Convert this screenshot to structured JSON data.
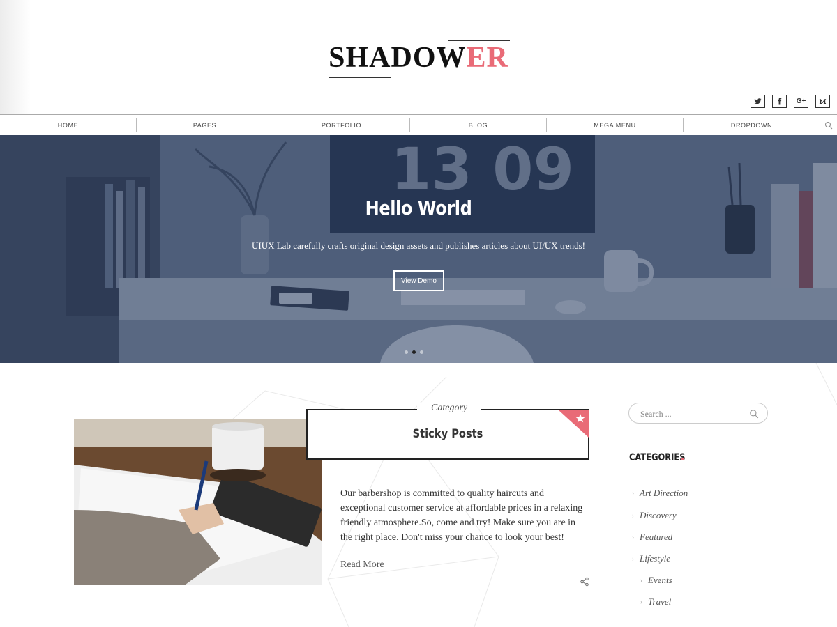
{
  "logo": {
    "main": "SHADOW",
    "accent": "ER"
  },
  "social": [
    {
      "name": "twitter",
      "icon": "twitter-icon"
    },
    {
      "name": "facebook",
      "icon": "facebook-icon"
    },
    {
      "name": "google-plus",
      "icon": "google-plus-icon",
      "label": "G+"
    },
    {
      "name": "medium",
      "icon": "medium-icon"
    }
  ],
  "nav": {
    "items": [
      "HOME",
      "PAGES",
      "PORTFOLIO",
      "BLOG",
      "MEGA MENU",
      "DROPDOWN"
    ],
    "search_icon": "search-icon"
  },
  "hero": {
    "clock": "13 09",
    "title": "Hello World",
    "subtitle": "UIUX Lab carefully crafts original design assets and publishes articles about UI/UX trends!",
    "button": "View Demo",
    "slides": 3,
    "active_slide": 2
  },
  "post": {
    "category": "Category",
    "title": "Sticky Posts",
    "excerpt": "Our barbershop is committed to quality haircuts and exceptional customer service at affordable prices in a relaxing friendly atmosphere.So, come and try! Make sure you are in the right place. Don't miss your chance to look your best!",
    "read_more": "Read More",
    "sticky_icon": "star-icon",
    "share_icon": "share-icon"
  },
  "sidebar": {
    "search_placeholder": "Search ...",
    "categories_title": "CATEGORIES",
    "categories": [
      "Art Direction",
      "Discovery",
      "Featured",
      "Lifestyle"
    ],
    "subcategories": [
      "Events",
      "Travel"
    ]
  },
  "colors": {
    "accent": "#e96b77",
    "hero_overlay": "#2c3e60",
    "text": "#333333"
  }
}
